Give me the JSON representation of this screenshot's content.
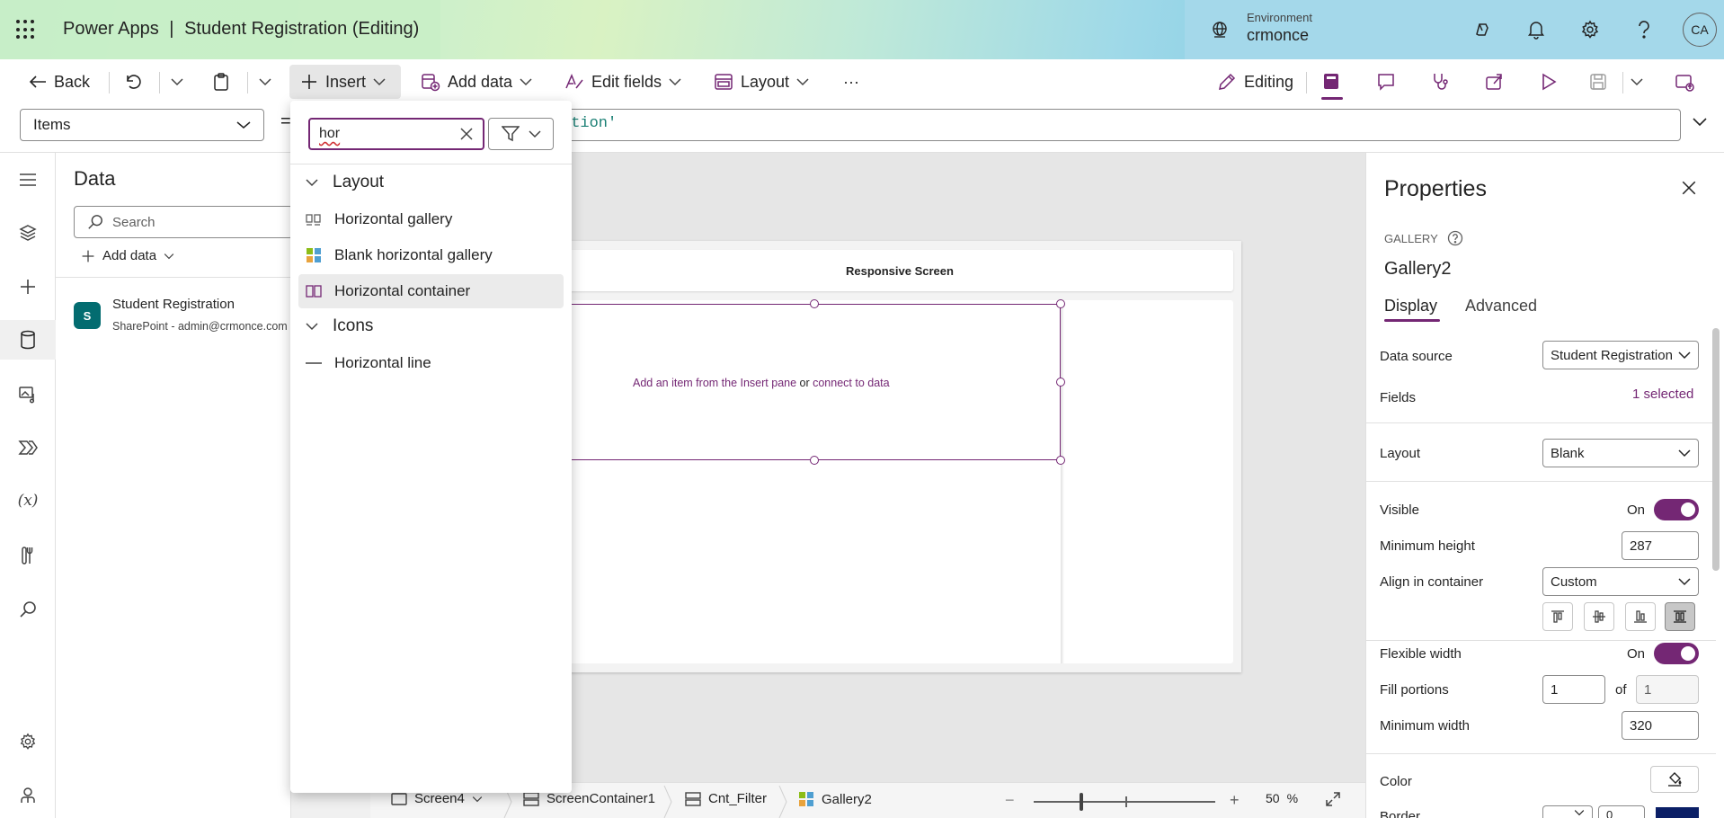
{
  "header": {
    "app_name": "Power Apps",
    "divider": "|",
    "doc_title": "Student Registration (Editing)",
    "env_label": "Environment",
    "env_name": "crmonce",
    "user_initials": "CA"
  },
  "commandbar": {
    "back": "Back",
    "insert": "Insert",
    "add_data": "Add data",
    "edit_fields": "Edit fields",
    "layout": "Layout",
    "more": "···",
    "editing": "Editing"
  },
  "formula": {
    "property": "Items",
    "equals": "=",
    "text": "ation'"
  },
  "data_pane": {
    "title": "Data",
    "search_placeholder": "Search",
    "add_data": "Add data",
    "source_icon_text": "S",
    "source_name": "Student Registration",
    "source_sub": "SharePoint - admin@crmonce.com"
  },
  "insert_pane": {
    "search_value": "hor",
    "groups": [
      {
        "label": "Layout",
        "items": [
          "Horizontal gallery",
          "Blank horizontal gallery",
          "Horizontal container"
        ]
      },
      {
        "label": "Icons",
        "items": [
          "Horizontal line"
        ]
      }
    ]
  },
  "canvas": {
    "screen_title": "Responsive Screen",
    "msg_part1": "Add an item from the Insert pane",
    "msg_or": " or ",
    "msg_part2": "connect to data"
  },
  "properties": {
    "title": "Properties",
    "control_type": "GALLERY",
    "control_name": "Gallery2",
    "tabs": [
      "Display",
      "Advanced"
    ],
    "data_source_label": "Data source",
    "data_source_value": "Student Registration",
    "fields_label": "Fields",
    "fields_value": "1 selected",
    "layout_label": "Layout",
    "layout_value": "Blank",
    "visible_label": "Visible",
    "visible_value": "On",
    "min_height_label": "Minimum height",
    "min_height_value": "287",
    "align_label": "Align in container",
    "align_value": "Custom",
    "flex_width_label": "Flexible width",
    "flex_width_value": "On",
    "fill_label": "Fill portions",
    "fill_value": "1",
    "fill_of": "of",
    "fill_total": "1",
    "min_width_label": "Minimum width",
    "min_width_value": "320",
    "color_label": "Color",
    "border_label": "Border",
    "border_value": "0"
  },
  "statusbar": {
    "crumbs": [
      "Screen4",
      "ScreenContainer1",
      "Cnt_Filter",
      "Gallery2"
    ],
    "zoom_minus": "−",
    "zoom_plus": "+",
    "zoom_value": "50",
    "zoom_unit": "%"
  },
  "colors": {
    "accent": "#742774",
    "canvas": "#e6e6e6"
  }
}
